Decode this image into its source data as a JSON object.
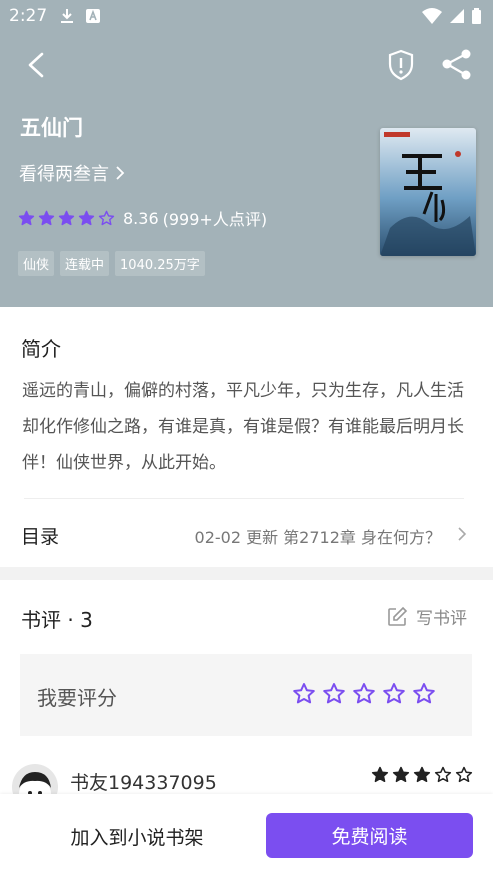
{
  "status_bar": {
    "time": "2:27",
    "colors": {
      "text": "#ffffff"
    }
  },
  "book": {
    "title": "五仙门",
    "author": "看得两叁言",
    "rating_value": 8.36,
    "rating_text": "8.36",
    "rating_count": "(999+人点评)",
    "stars_filled": 4,
    "stars_total": 5,
    "tags": [
      "仙侠",
      "连载中",
      "1040.25万字"
    ]
  },
  "intro": {
    "heading": "简介",
    "text": "遥远的青山，偏僻的村落，平凡少年，只为生存，凡人生活却化作修仙之路，有谁是真，有谁是假？有谁能最后明月长伴！仙侠世界，从此开始。"
  },
  "toc": {
    "label": "目录",
    "latest": "02-02  更新  第2712章 身在何方？"
  },
  "reviews": {
    "heading": "书评 · 3",
    "write_label": "写书评",
    "rate_label": "我要评分",
    "items": [
      {
        "name": "书友194337095",
        "stars": 3
      }
    ]
  },
  "bottom_bar": {
    "add_shelf": "加入到小说书架",
    "read": "免费阅读"
  },
  "colors": {
    "accent": "#7b4ef0",
    "header_bg": "#a3b2b8"
  },
  "icons": [
    "back-icon",
    "shield-alert-icon",
    "share-icon",
    "chevron-right-icon",
    "star-icon",
    "edit-icon"
  ]
}
